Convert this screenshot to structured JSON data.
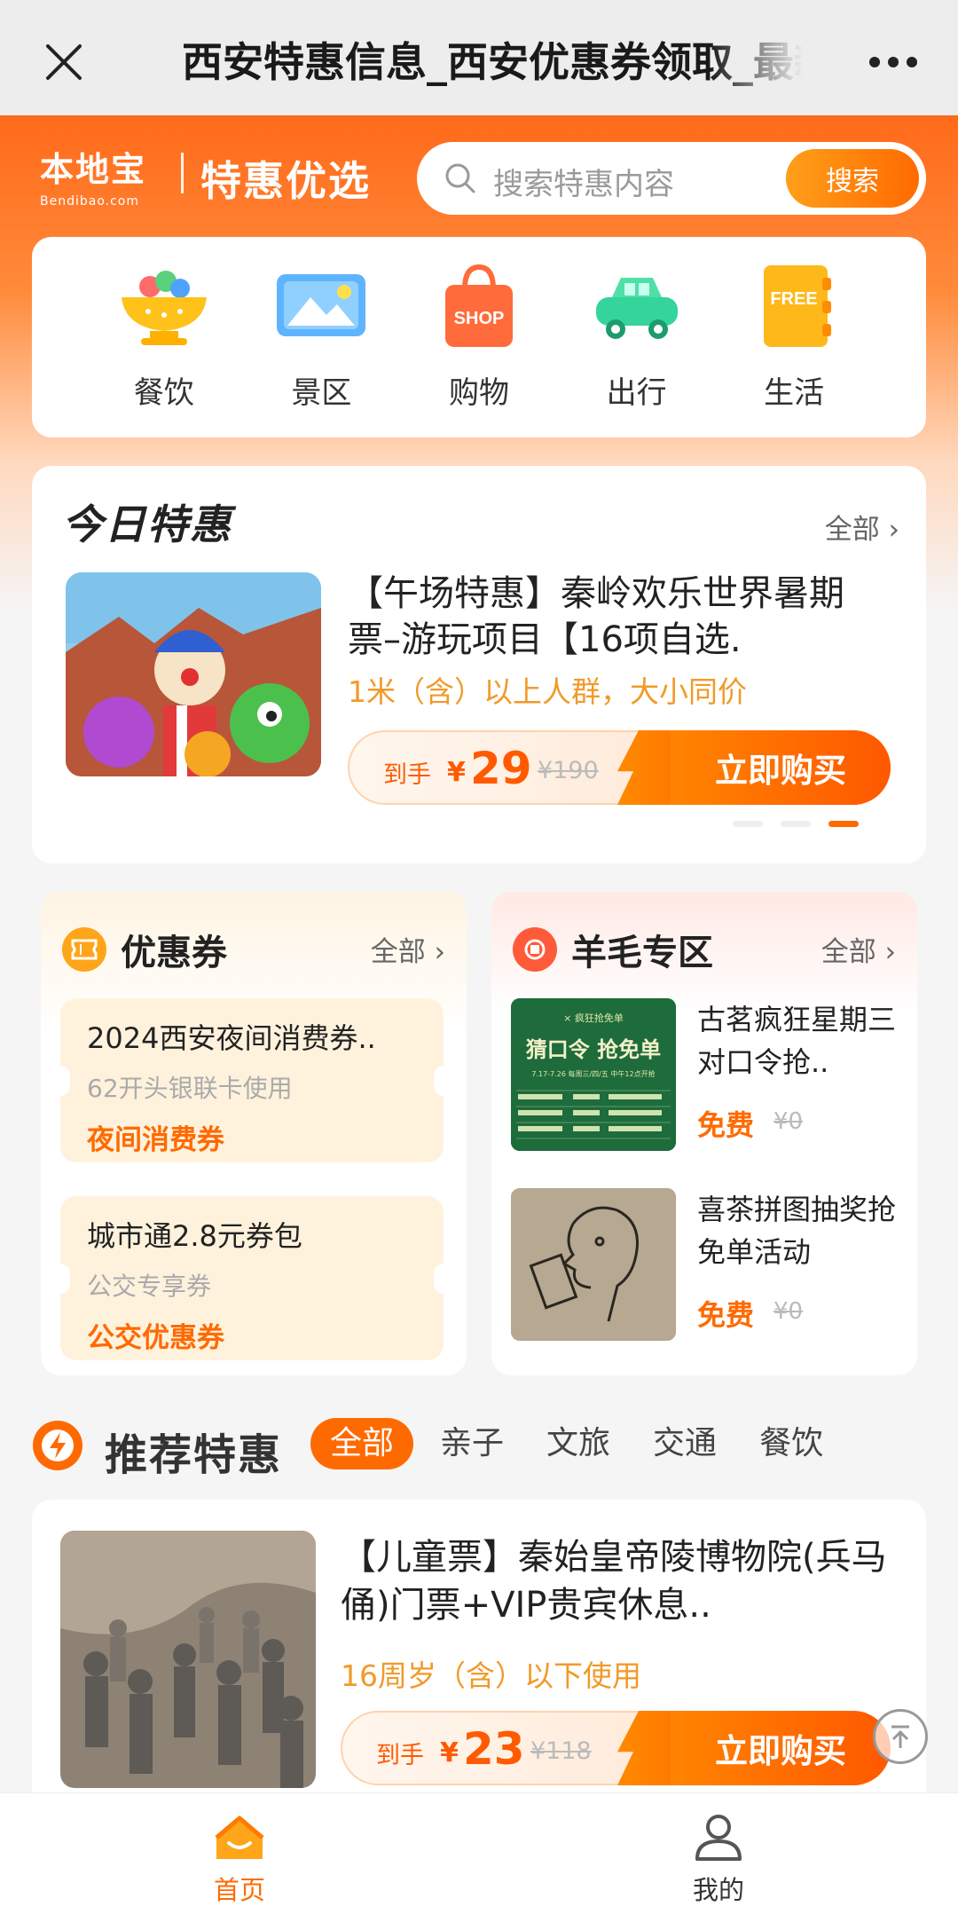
{
  "navbar": {
    "title": "西安特惠信息_西安优惠券领取_最新",
    "close_icon": "close-icon",
    "more_icon": "more-dots-icon"
  },
  "header": {
    "logo_main": "本地宝",
    "logo_sub": "Bendibao.com",
    "slogan": "特惠优选",
    "search_placeholder": "搜索特惠内容",
    "search_button": "搜索"
  },
  "categories": [
    {
      "label": "餐饮",
      "icon": "food-bowl-icon"
    },
    {
      "label": "景区",
      "icon": "scenic-picture-icon"
    },
    {
      "label": "购物",
      "icon": "shopping-bag-icon"
    },
    {
      "label": "出行",
      "icon": "car-icon"
    },
    {
      "label": "生活",
      "icon": "free-notebook-icon"
    }
  ],
  "today": {
    "title": "今日特惠",
    "more": "全部",
    "item": {
      "name": "【午场特惠】秦岭欢乐世界暑期票–游玩项目【16项自选.",
      "desc": "1米（含）以上人群，大小同价",
      "price_label": "到手",
      "currency": "¥",
      "price": "29",
      "original": "¥190",
      "buy": "立即购买"
    },
    "carousel_active": 3,
    "carousel_total": 3
  },
  "coupons": {
    "title": "优惠券",
    "more": "全部",
    "items": [
      {
        "title": "2024西安夜间消费券..",
        "sub": "62开头银联卡使用",
        "tag": "夜间消费券"
      },
      {
        "title": "城市通2.8元券包",
        "sub": "公交专享券",
        "tag": "公交优惠券"
      }
    ]
  },
  "wool": {
    "title": "羊毛专区",
    "more": "全部",
    "items": [
      {
        "name": "古茗疯狂星期三对口令抢..",
        "price": "免费",
        "original": "¥0",
        "img_text": "猜口令 抢免单",
        "img_top": "× 疯狂抢免单",
        "img_dates": "7.17-7.26 每周三/四/五 中午12点开抢"
      },
      {
        "name": "喜茶拼图抽奖抢免单活动",
        "price": "免费",
        "original": "¥0"
      }
    ]
  },
  "recommend": {
    "title": "推荐特惠",
    "tabs": [
      "全部",
      "亲子",
      "文旅",
      "交通",
      "餐饮"
    ],
    "active_tab": 0,
    "item": {
      "name": "【儿童票】秦始皇帝陵博物院(兵马俑)门票+VIP贵宾休息..",
      "desc": "16周岁（含）以下使用",
      "price_label": "到手",
      "currency": "¥",
      "price": "23",
      "original": "¥118",
      "buy": "立即购买"
    }
  },
  "tabbar": {
    "home": "首页",
    "mine": "我的"
  },
  "colors": {
    "brand_orange": "#ff6a00",
    "accent_yellow": "#f19a2a",
    "nav_bg": "#ededed"
  }
}
